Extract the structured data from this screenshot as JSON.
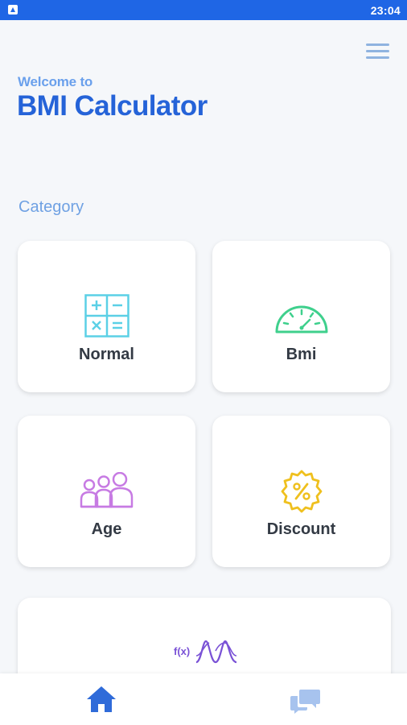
{
  "status_bar": {
    "time": "23:04"
  },
  "header": {
    "welcome": "Welcome to",
    "title": "BMI Calculator",
    "menu_icon": "hamburger-menu-icon"
  },
  "section": {
    "title": "Category"
  },
  "categories": [
    {
      "label": "Normal",
      "icon": "calculator-icon",
      "color": "#5bd0e6"
    },
    {
      "label": "Bmi",
      "icon": "gauge-icon",
      "color": "#3fd08d"
    },
    {
      "label": "Age",
      "icon": "people-icon",
      "color": "#c77be3"
    },
    {
      "label": "Discount",
      "icon": "discount-badge-icon",
      "color": "#efc01e"
    },
    {
      "label": "f(x)",
      "icon": "function-graph-icon",
      "color": "#7a52d6"
    }
  ],
  "bottom_nav": {
    "items": [
      {
        "icon": "home-icon",
        "active": true,
        "color": "#2f6bd9"
      },
      {
        "icon": "chat-icon",
        "active": false,
        "color": "#a7c3ee"
      }
    ]
  },
  "colors": {
    "accent": "#2563d8",
    "status_bar": "#1f66e5",
    "background": "#f5f7fa"
  }
}
